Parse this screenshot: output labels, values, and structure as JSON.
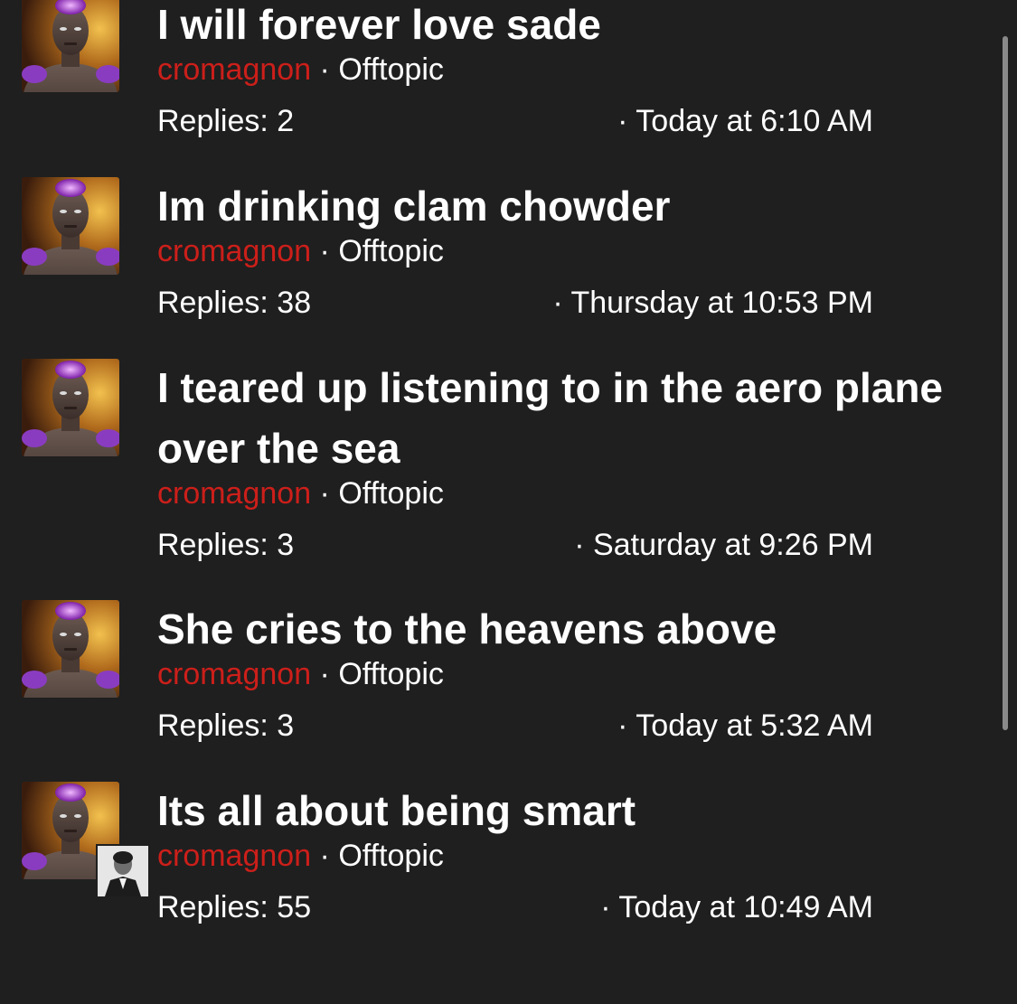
{
  "threads": [
    {
      "title": "I will forever love sade",
      "author": "cromagnon",
      "separator": " · ",
      "forum": "Offtopic",
      "replies": "Replies: 2",
      "time": "· Today at 6:10 AM"
    },
    {
      "title": "Im drinking clam chowder",
      "author": "cromagnon",
      "separator": " · ",
      "forum": "Offtopic",
      "replies": "Replies: 38",
      "time": "· Thursday at 10:53 PM"
    },
    {
      "title": "I teared up listening to in the aero plane over the sea",
      "author": "cromagnon",
      "separator": " · ",
      "forum": "Offtopic",
      "replies": "Replies: 3",
      "time": "· Saturday at 9:26 PM"
    },
    {
      "title": "She cries to the heavens above",
      "author": "cromagnon",
      "separator": " · ",
      "forum": "Offtopic",
      "replies": "Replies: 3",
      "time": "· Today at 5:32 AM"
    },
    {
      "title": "Its all about being smart",
      "author": "cromagnon",
      "separator": " · ",
      "forum": "Offtopic",
      "replies": "Replies: 55",
      "time": "· Today at 10:49 AM"
    }
  ],
  "colors": {
    "background": "#1f1f1f",
    "author": "#cc1f1a",
    "text": "#ffffff"
  }
}
